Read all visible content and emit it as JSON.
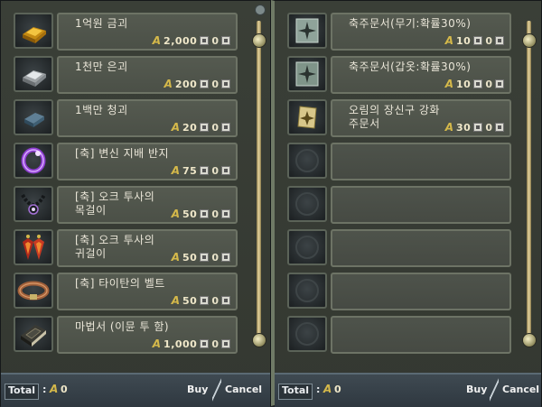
{
  "left_panel": {
    "items": [
      {
        "name": "1억원 금괴",
        "price": "2,000",
        "icon": "gold-bar-icon"
      },
      {
        "name": "1천만 은괴",
        "price": "200",
        "icon": "silver-bar-icon"
      },
      {
        "name": "1백만 청괴",
        "price": "20",
        "icon": "blue-bar-icon"
      },
      {
        "name": "[축] 변신 지배 반지",
        "price": "75",
        "icon": "purple-ring-icon"
      },
      {
        "name": "[축] 오크 투사의\n목걸이",
        "price": "50",
        "icon": "necklace-icon"
      },
      {
        "name": "[축] 오크 투사의\n귀걸이",
        "price": "50",
        "icon": "earring-icon"
      },
      {
        "name": "[축] 타이탄의 벨트",
        "price": "50",
        "icon": "belt-icon"
      },
      {
        "name": "마법서 (이뮨 투 함)",
        "price": "1,000",
        "icon": "spellbook-icon"
      }
    ],
    "total_label": "Total",
    "total_sep": ":",
    "total_value": "0",
    "buy_label": "Buy",
    "cancel_label": "Cancel"
  },
  "right_panel": {
    "items": [
      {
        "name": "축주문서(무기:확률30%)",
        "price": "10",
        "icon": "weapon-scroll-icon"
      },
      {
        "name": "축주문서(갑옷:확률30%)",
        "price": "10",
        "icon": "armor-scroll-icon"
      },
      {
        "name": "오림의 장신구 강화\n주문서",
        "price": "30",
        "icon": "orim-scroll-icon"
      },
      {
        "name": "",
        "price": "",
        "icon": "empty-slot-icon"
      },
      {
        "name": "",
        "price": "",
        "icon": "empty-slot-icon"
      },
      {
        "name": "",
        "price": "",
        "icon": "empty-slot-icon"
      },
      {
        "name": "",
        "price": "",
        "icon": "empty-slot-icon"
      },
      {
        "name": "",
        "price": "",
        "icon": "empty-slot-icon"
      }
    ],
    "total_label": "Total",
    "total_sep": ":",
    "total_value": "0",
    "buy_label": "Buy",
    "cancel_label": "Cancel"
  },
  "adena_symbol": "A",
  "qty_zero": "0",
  "colors": {
    "panel": "#3a3f37",
    "item_box": "#555a50",
    "text": "#eae6d8",
    "adena": "#d4b84a"
  }
}
